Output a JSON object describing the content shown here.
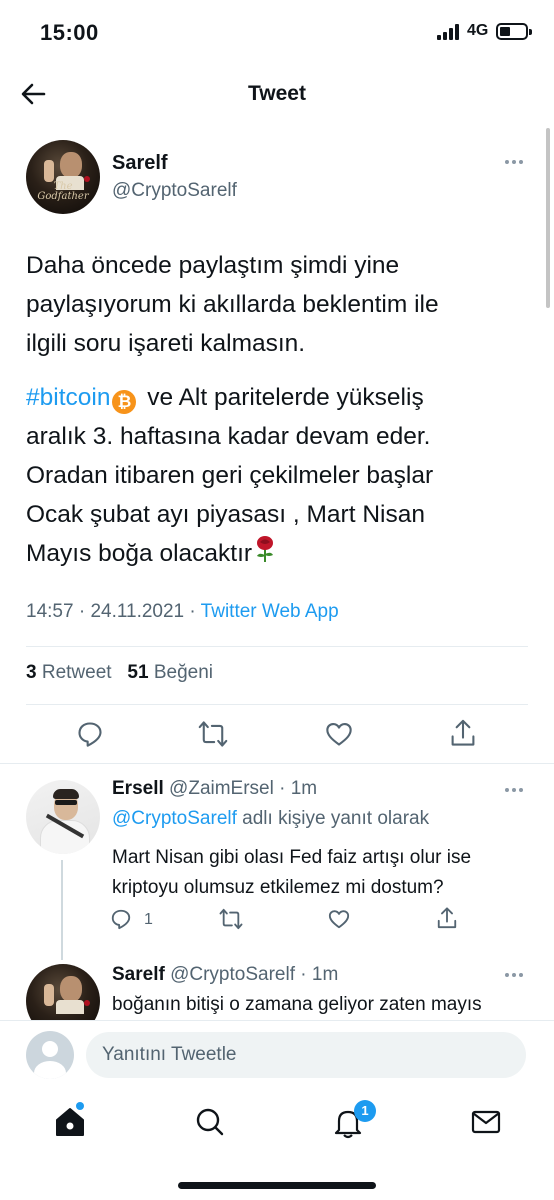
{
  "status_bar": {
    "time": "15:00",
    "network": "4G"
  },
  "header": {
    "title": "Tweet",
    "back_icon": "arrow-left-icon"
  },
  "tweet": {
    "author_name": "Sarelf",
    "author_handle": "@CryptoSarelf",
    "avatar_text": "The Godfather",
    "paragraph_1": "Daha öncede paylaştım şimdi yine\npaylaşıyorum ki akıllarda beklentim ile\nilgili soru işareti kalmasın.",
    "hashtag": "#bitcoin",
    "bitcoin_emoji": "₿",
    "paragraph_2_line_1": " ve Alt paritelerde yükseliş",
    "paragraph_2_rest": "aralık 3. haftasına kadar devam eder.\nOradan itibaren geri çekilmeler başlar\nOcak şubat ayı piyasası , Mart Nisan\nMayıs boğa olacaktır",
    "time": "14:57",
    "date": "24.11.2021",
    "separator": "·",
    "source": "Twitter Web App",
    "retweet_count": "3",
    "retweet_label": "Retweet",
    "like_count": "51",
    "like_label": "Beğeni"
  },
  "reply_1": {
    "author_name": "Ersell",
    "author_handle": "@ZaimErsel",
    "separator": "·",
    "time": "1m",
    "reply_to_mention": "@CryptoSarelf",
    "reply_to_suffix": " adlı kişiye yanıt olarak",
    "text": "Mart Nisan gibi olası Fed faiz artışı olur ise\nkriptoyu olumsuz etkilemez mi  dostum?",
    "reply_count": "1"
  },
  "reply_2": {
    "author_name": "Sarelf",
    "author_handle": "@CryptoSarelf",
    "separator": "·",
    "time": "1m",
    "text": "boğanın bitişi o zamana geliyor zaten mayıs"
  },
  "compose": {
    "placeholder": "Yanıtını Tweetle"
  },
  "bottom_nav": {
    "items": [
      "home-icon",
      "search-icon",
      "notifications-icon",
      "messages-icon"
    ],
    "notification_badge": "1"
  },
  "colors": {
    "accent": "#1d9bf0",
    "text": "#0f1419",
    "secondary": "#536471",
    "divider": "#e6ecf0",
    "bitcoin": "#f7931a"
  }
}
